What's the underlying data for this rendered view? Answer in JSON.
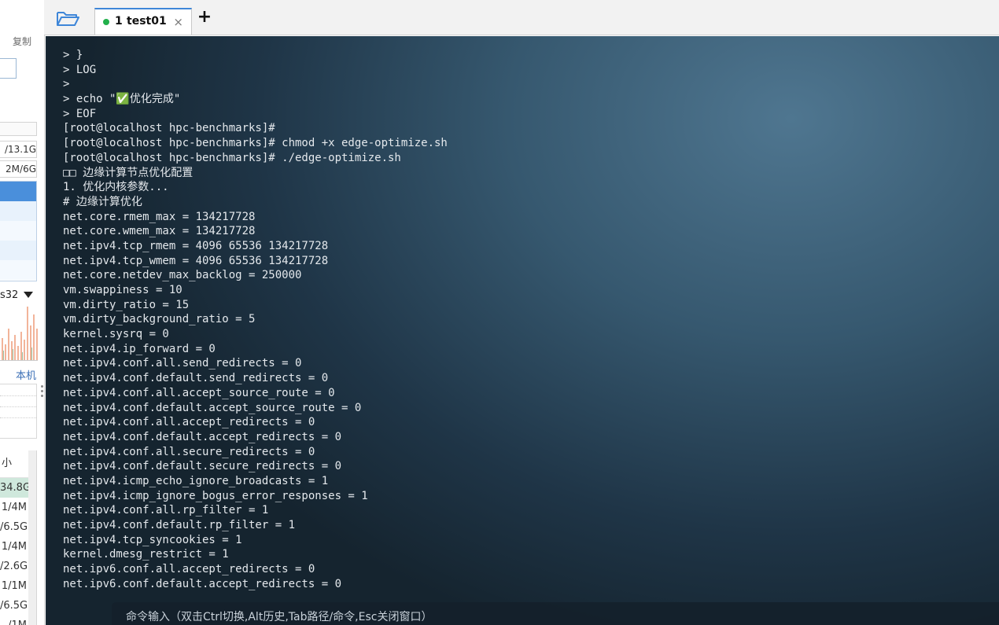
{
  "left_panel": {
    "copy_label": "复制",
    "stats": [
      "/13.1G",
      "2M/6G"
    ],
    "select_label": "s32",
    "local_label": "本机",
    "table": {
      "header": "小",
      "cells": [
        "34.8G",
        "1/4M",
        "/6.5G",
        "1/4M",
        "/2.6G",
        "1/1M",
        "/6.5G",
        "/1M"
      ]
    }
  },
  "tabbar": {
    "folder_icon": "folder-open-icon",
    "tab": {
      "number": "1",
      "title": "test01",
      "close": "×",
      "status_color": "#22b04b"
    },
    "add_tab": "+"
  },
  "terminal": {
    "lines": [
      "> }",
      "> LOG",
      ">",
      "> echo \"✅优化完成\"",
      "> EOF",
      "[root@localhost hpc-benchmarks]#",
      "[root@localhost hpc-benchmarks]# chmod +x edge-optimize.sh",
      "[root@localhost hpc-benchmarks]# ./edge-optimize.sh",
      "□□ 边缘计算节点优化配置",
      "1. 优化内核参数...",
      "# 边缘计算优化",
      "net.core.rmem_max = 134217728",
      "net.core.wmem_max = 134217728",
      "net.ipv4.tcp_rmem = 4096 65536 134217728",
      "net.ipv4.tcp_wmem = 4096 65536 134217728",
      "net.core.netdev_max_backlog = 250000",
      "vm.swappiness = 10",
      "vm.dirty_ratio = 15",
      "vm.dirty_background_ratio = 5",
      "kernel.sysrq = 0",
      "net.ipv4.ip_forward = 0",
      "net.ipv4.conf.all.send_redirects = 0",
      "net.ipv4.conf.default.send_redirects = 0",
      "net.ipv4.conf.all.accept_source_route = 0",
      "net.ipv4.conf.default.accept_source_route = 0",
      "net.ipv4.conf.all.accept_redirects = 0",
      "net.ipv4.conf.default.accept_redirects = 0",
      "net.ipv4.conf.all.secure_redirects = 0",
      "net.ipv4.conf.default.secure_redirects = 0",
      "net.ipv4.icmp_echo_ignore_broadcasts = 1",
      "net.ipv4.icmp_ignore_bogus_error_responses = 1",
      "net.ipv4.conf.all.rp_filter = 1",
      "net.ipv4.conf.default.rp_filter = 1",
      "net.ipv4.tcp_syncookies = 1",
      "kernel.dmesg_restrict = 1",
      "net.ipv6.conf.all.accept_redirects = 0",
      "net.ipv6.conf.default.accept_redirects = 0"
    ],
    "command_hint": "命令输入（双击Ctrl切换,Alt历史,Tab路径/命令,Esc关闭窗口）"
  },
  "colors": {
    "accent": "#3e86d8",
    "terminal_text": "#e4e8ec",
    "terminal_bg": "#2c4a60",
    "connected": "#22b04b"
  }
}
